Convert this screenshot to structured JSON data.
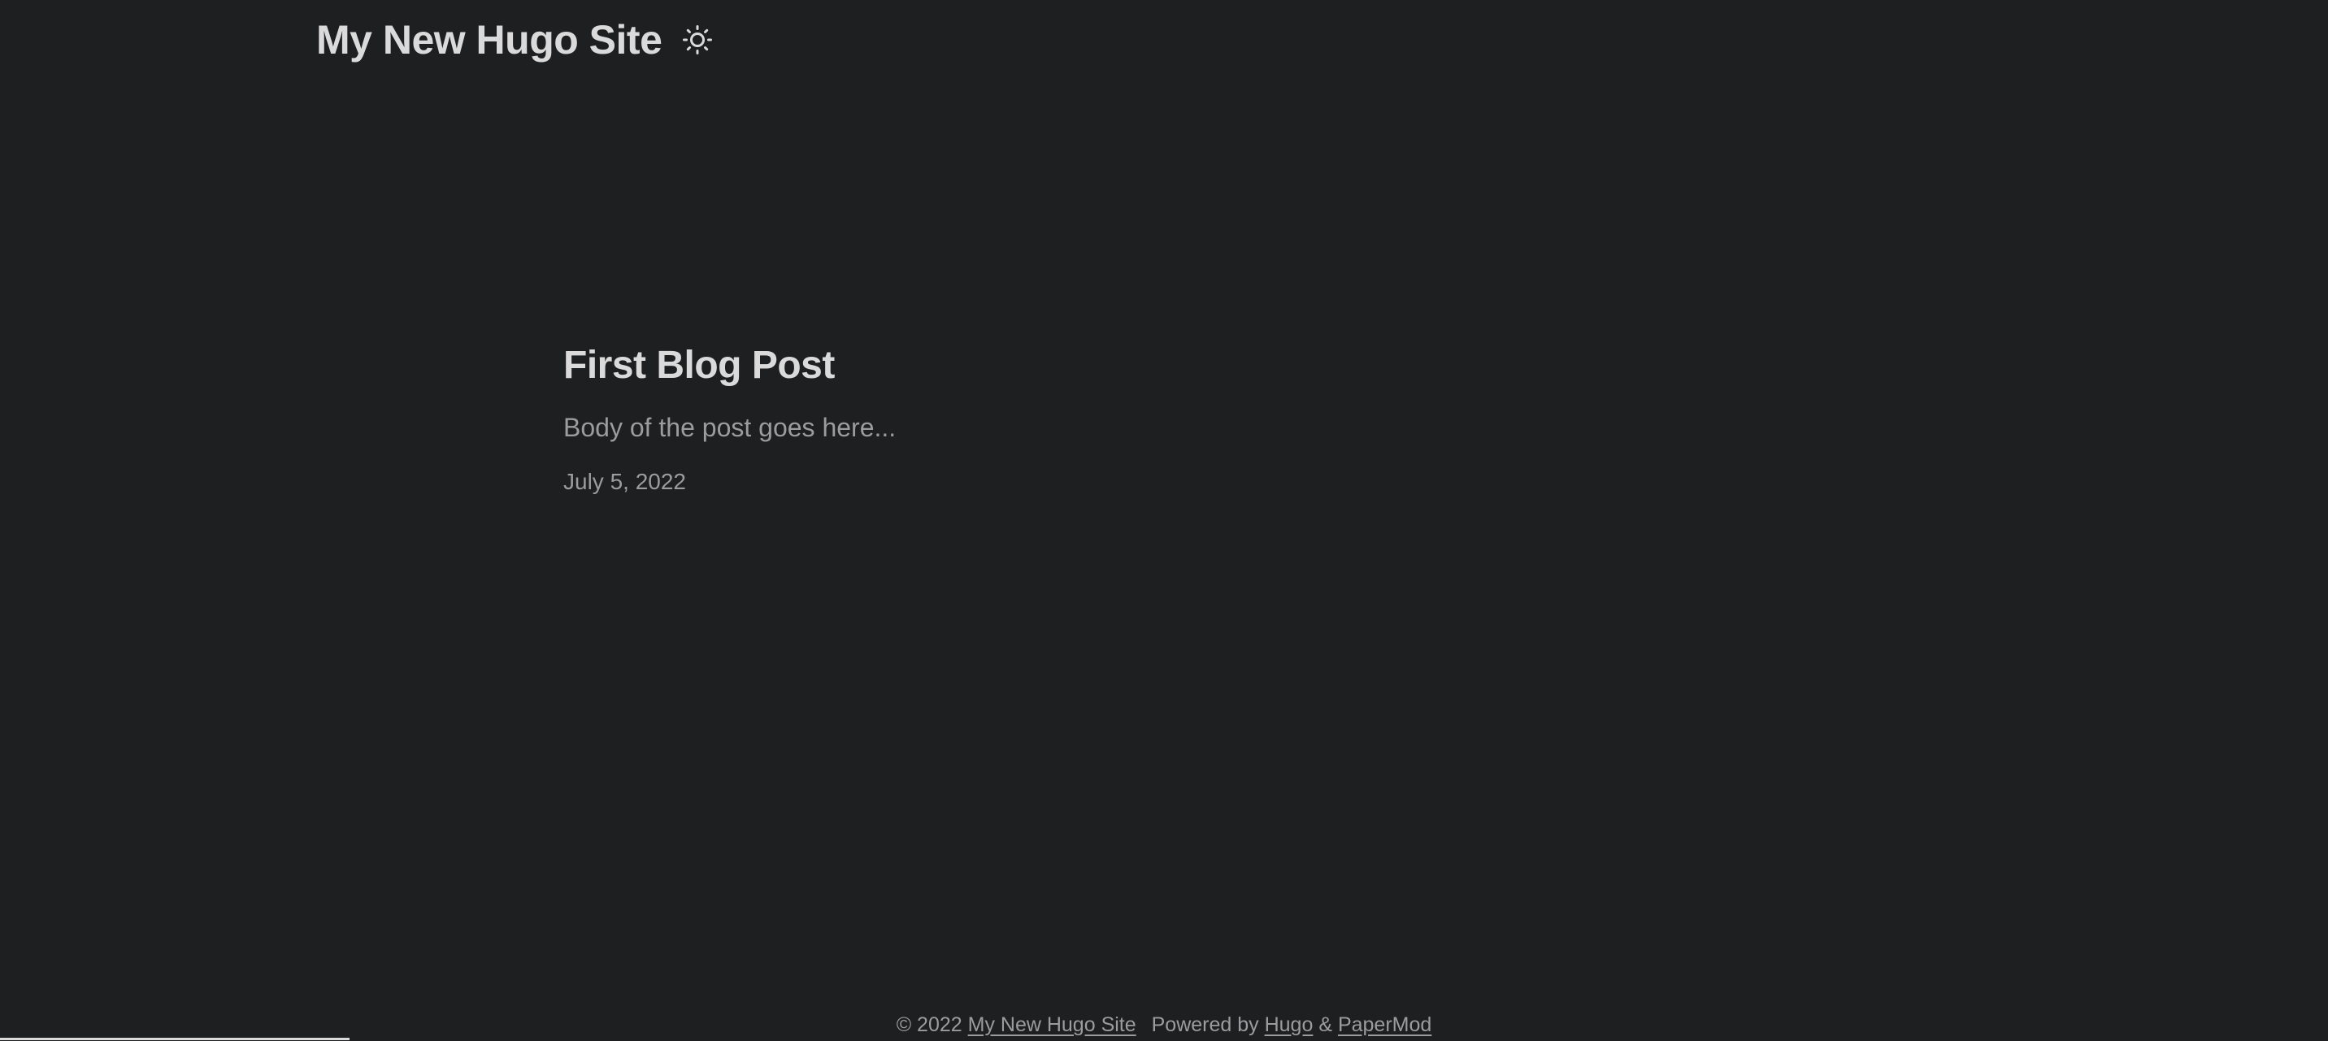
{
  "header": {
    "site_title": "My New Hugo Site",
    "theme_toggle_icon": "sun-icon"
  },
  "post": {
    "title": "First Blog Post",
    "summary": "Body of the post goes here...",
    "date": "July 5, 2022"
  },
  "footer": {
    "copyright": "© 2022",
    "site_link": "My New Hugo Site",
    "powered_by": "Powered by",
    "hugo_link": "Hugo",
    "ampersand": "&",
    "papermod_link": "PaperMod"
  },
  "colors": {
    "background": "#1e1f21",
    "primary_text": "#dadadb",
    "secondary_text": "#9b9c9d"
  }
}
